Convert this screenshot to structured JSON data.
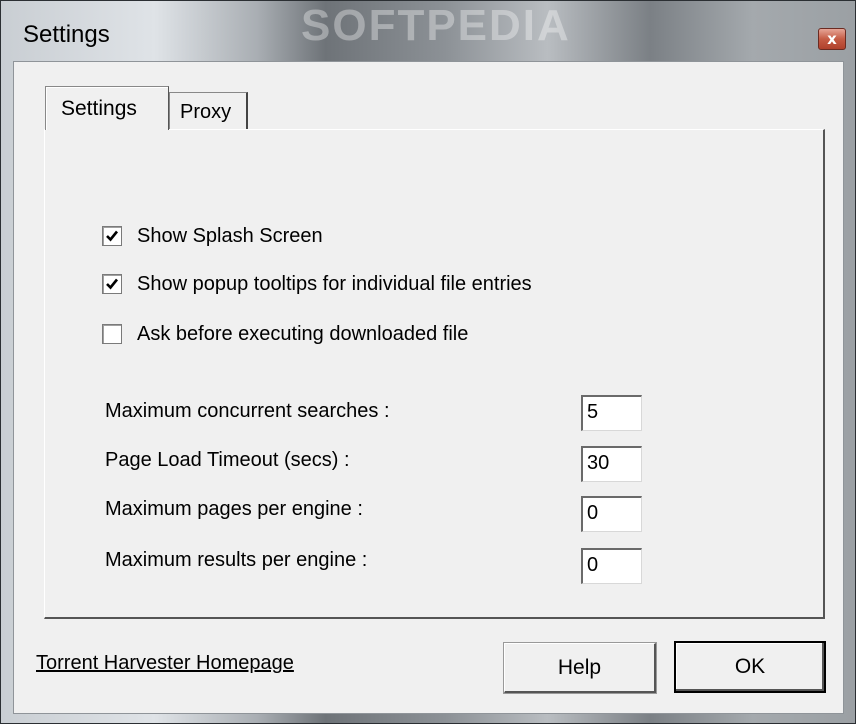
{
  "window": {
    "title": "Settings",
    "close_glyph": "x"
  },
  "tabs": [
    {
      "label": "Settings",
      "active": true
    },
    {
      "label": "Proxy",
      "active": false
    }
  ],
  "checkboxes": [
    {
      "label": "Show Splash Screen",
      "checked": true
    },
    {
      "label": "Show popup tooltips for individual file entries",
      "checked": true
    },
    {
      "label": "Ask before executing downloaded file",
      "checked": false
    }
  ],
  "fields": [
    {
      "label": "Maximum concurrent searches :",
      "value": "5"
    },
    {
      "label": "Page Load Timeout (secs)  :",
      "value": "30"
    },
    {
      "label": "Maximum pages per engine :",
      "value": "0"
    },
    {
      "label": "Maximum results per engine  :",
      "value": "0"
    }
  ],
  "footer": {
    "homepage_link": "Torrent Harvester Homepage",
    "help_label": "Help",
    "ok_label": "OK"
  },
  "watermark": "SOFTPEDIA",
  "colors": {
    "dialog_bg": "#f0f0f0",
    "close_button": "#c55c45"
  }
}
